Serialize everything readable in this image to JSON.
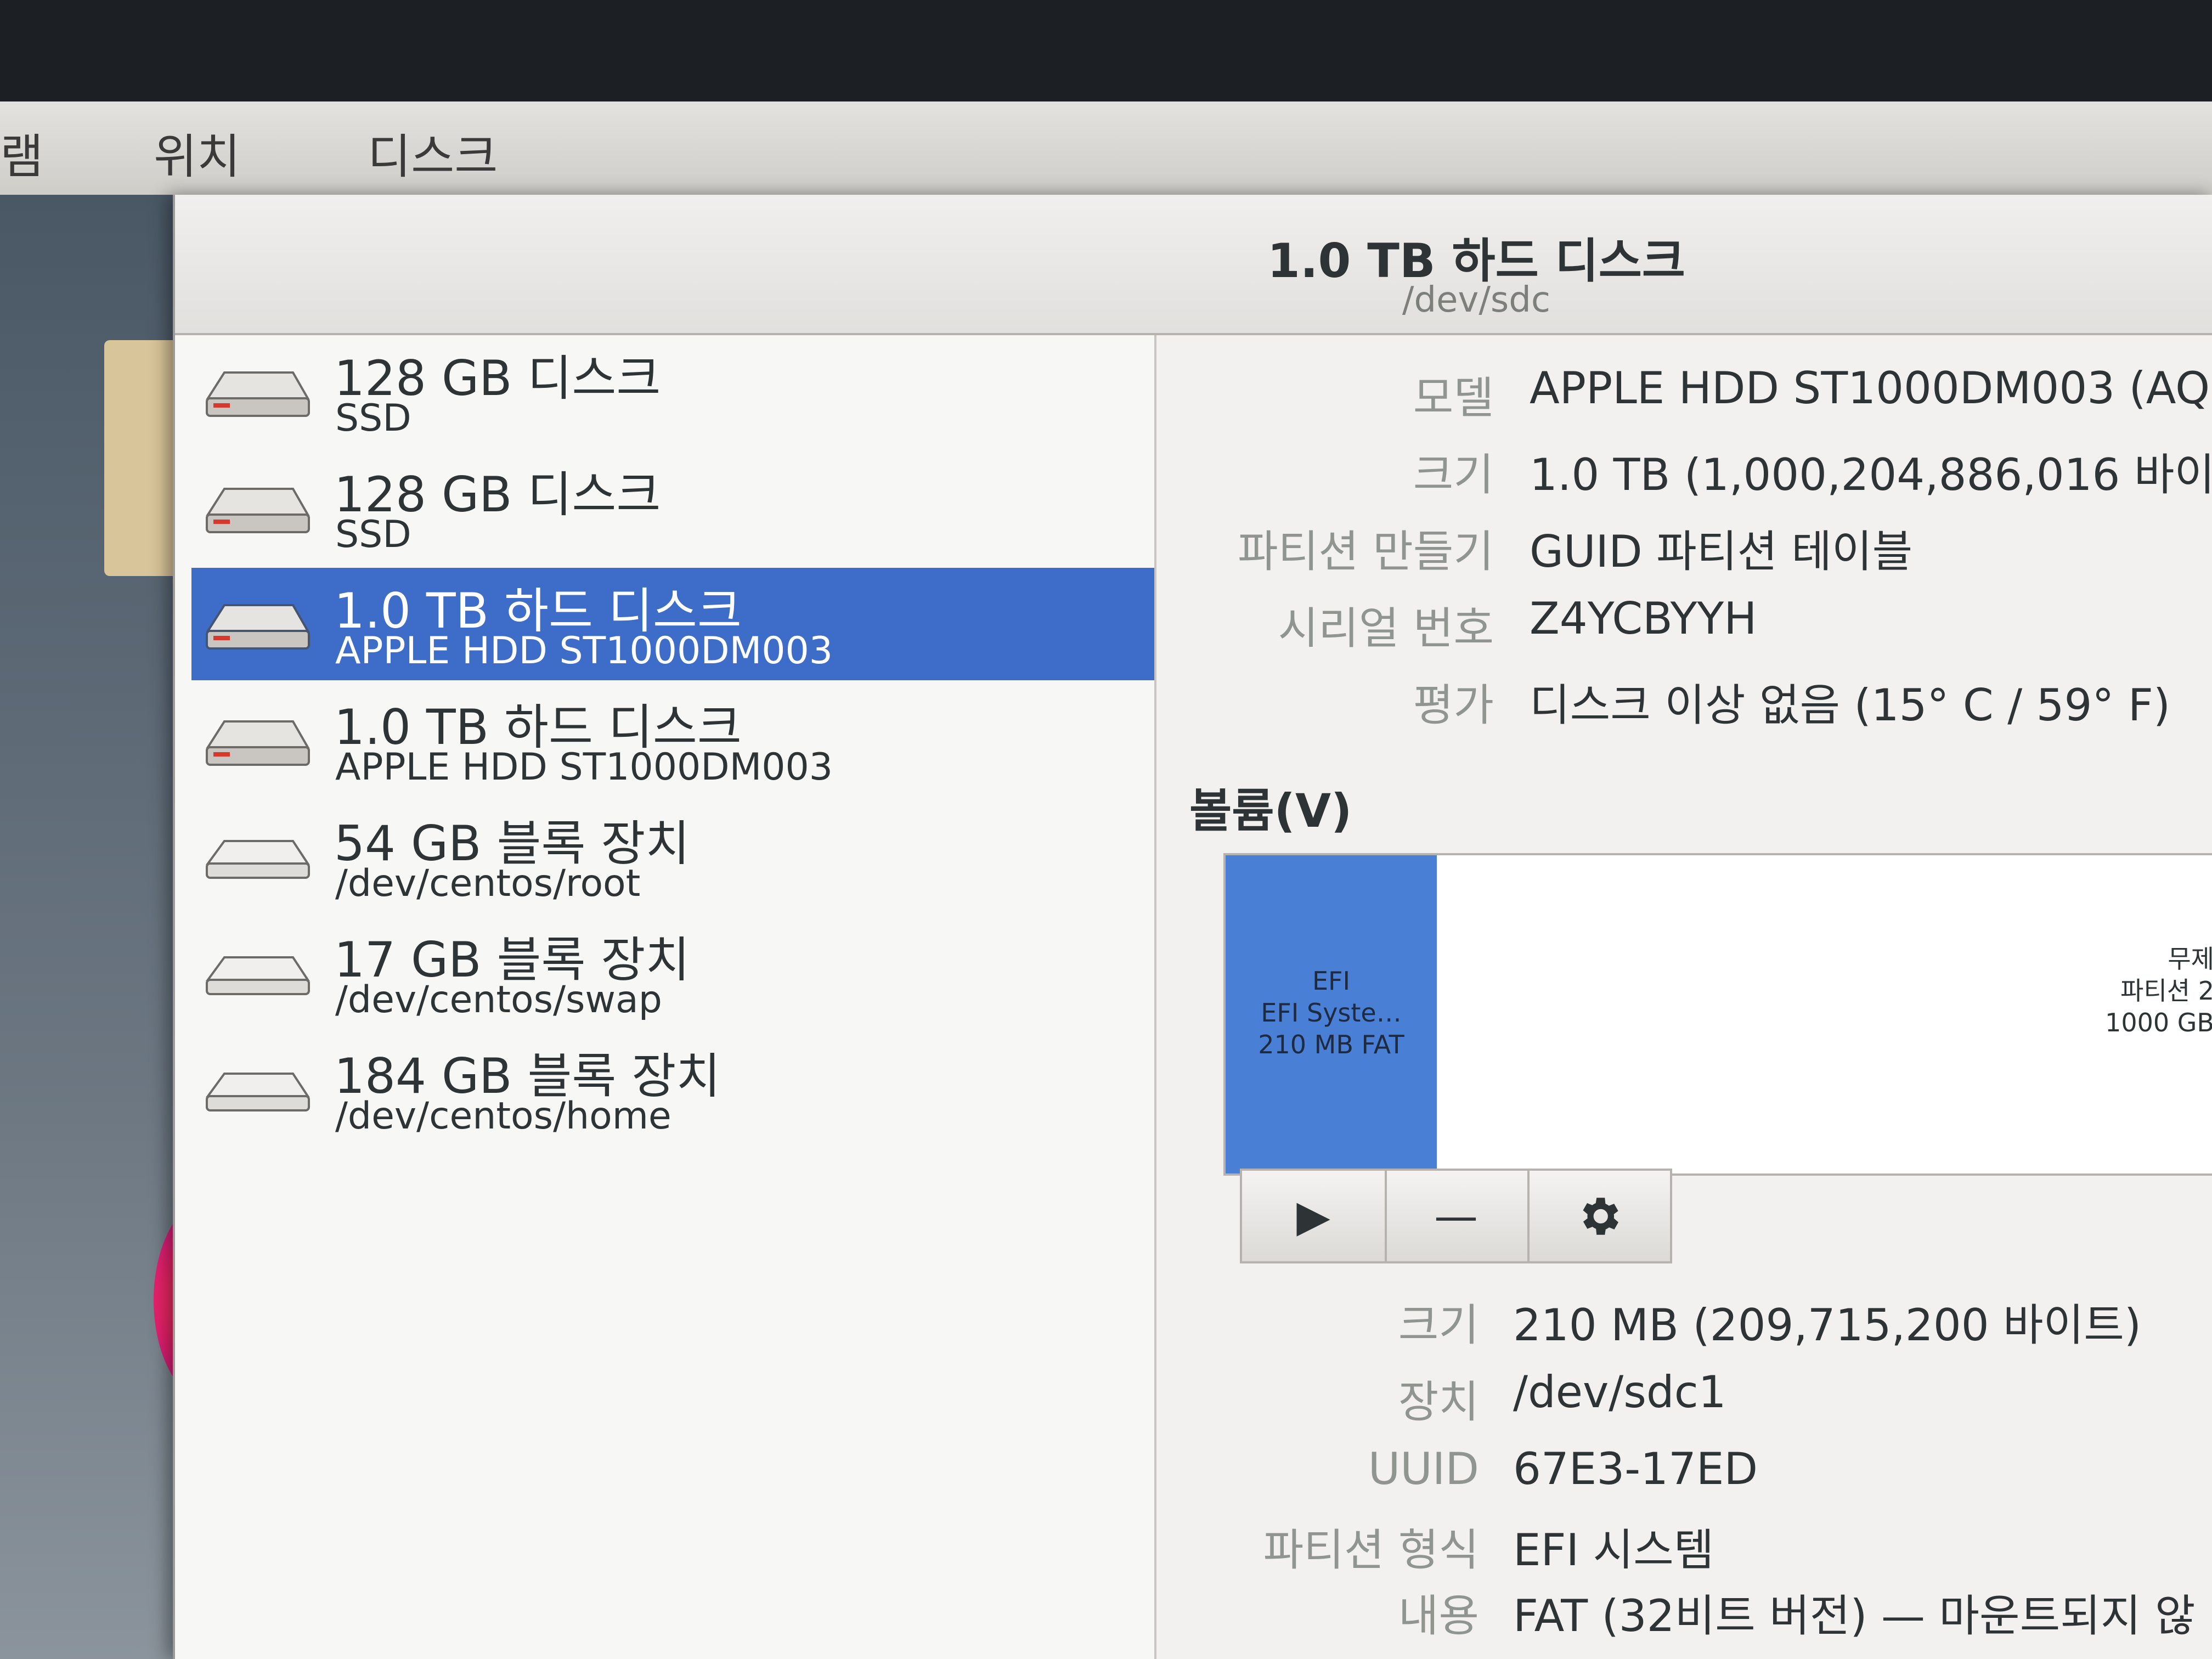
{
  "topbar": {
    "menus": [
      "램",
      "위치",
      "디스크"
    ]
  },
  "header": {
    "title": "1.0 TB 하드 디스크",
    "subtitle": "/dev/sdc"
  },
  "sidebar": {
    "drives": [
      {
        "title": "128 GB 디스크",
        "sub": "SSD",
        "icon": "drive-icon"
      },
      {
        "title": "128 GB 디스크",
        "sub": "SSD",
        "icon": "drive-icon"
      },
      {
        "title": "1.0 TB 하드 디스크",
        "sub": "APPLE HDD ST1000DM003",
        "icon": "drive-icon",
        "selected": true
      },
      {
        "title": "1.0 TB 하드 디스크",
        "sub": "APPLE HDD ST1000DM003",
        "icon": "drive-icon"
      },
      {
        "title": "54 GB 블록 장치",
        "sub": "/dev/centos/root",
        "icon": "block-device-icon"
      },
      {
        "title": "17 GB 블록 장치",
        "sub": "/dev/centos/swap",
        "icon": "block-device-icon"
      },
      {
        "title": "184 GB 블록 장치",
        "sub": "/dev/centos/home",
        "icon": "block-device-icon"
      }
    ]
  },
  "disk_info": {
    "model_label": "모델",
    "model": "APPLE HDD ST1000DM003 (AQ",
    "size_label": "크기",
    "size": "1.0 TB (1,000,204,886,016 바이",
    "partitioning_label": "파티션 만들기",
    "partitioning": "GUID 파티션 테이블",
    "serial_label": "시리얼 번호",
    "serial": "Z4YCBYYH",
    "assessment_label": "평가",
    "assessment": "디스크 이상 없음 (15° C / 59° F)"
  },
  "volumes": {
    "section_label": "볼륨(V)",
    "efi_block": [
      "EFI",
      "EFI Syste…",
      "210 MB FAT"
    ],
    "free_block": [
      "무제",
      "파티션 2",
      "1000 GB"
    ],
    "toolbar": {
      "play": "▶",
      "minus": "—"
    }
  },
  "partition_info": {
    "size_label": "크기",
    "size": "210 MB (209,715,200 바이트)",
    "device_label": "장치",
    "device": "/dev/sdc1",
    "uuid_label": "UUID",
    "uuid": "67E3-17ED",
    "type_label": "파티션 형식",
    "type": "EFI 시스템",
    "contents_label": "내용",
    "contents": "FAT (32비트 버전) — 마운트되지 않"
  }
}
